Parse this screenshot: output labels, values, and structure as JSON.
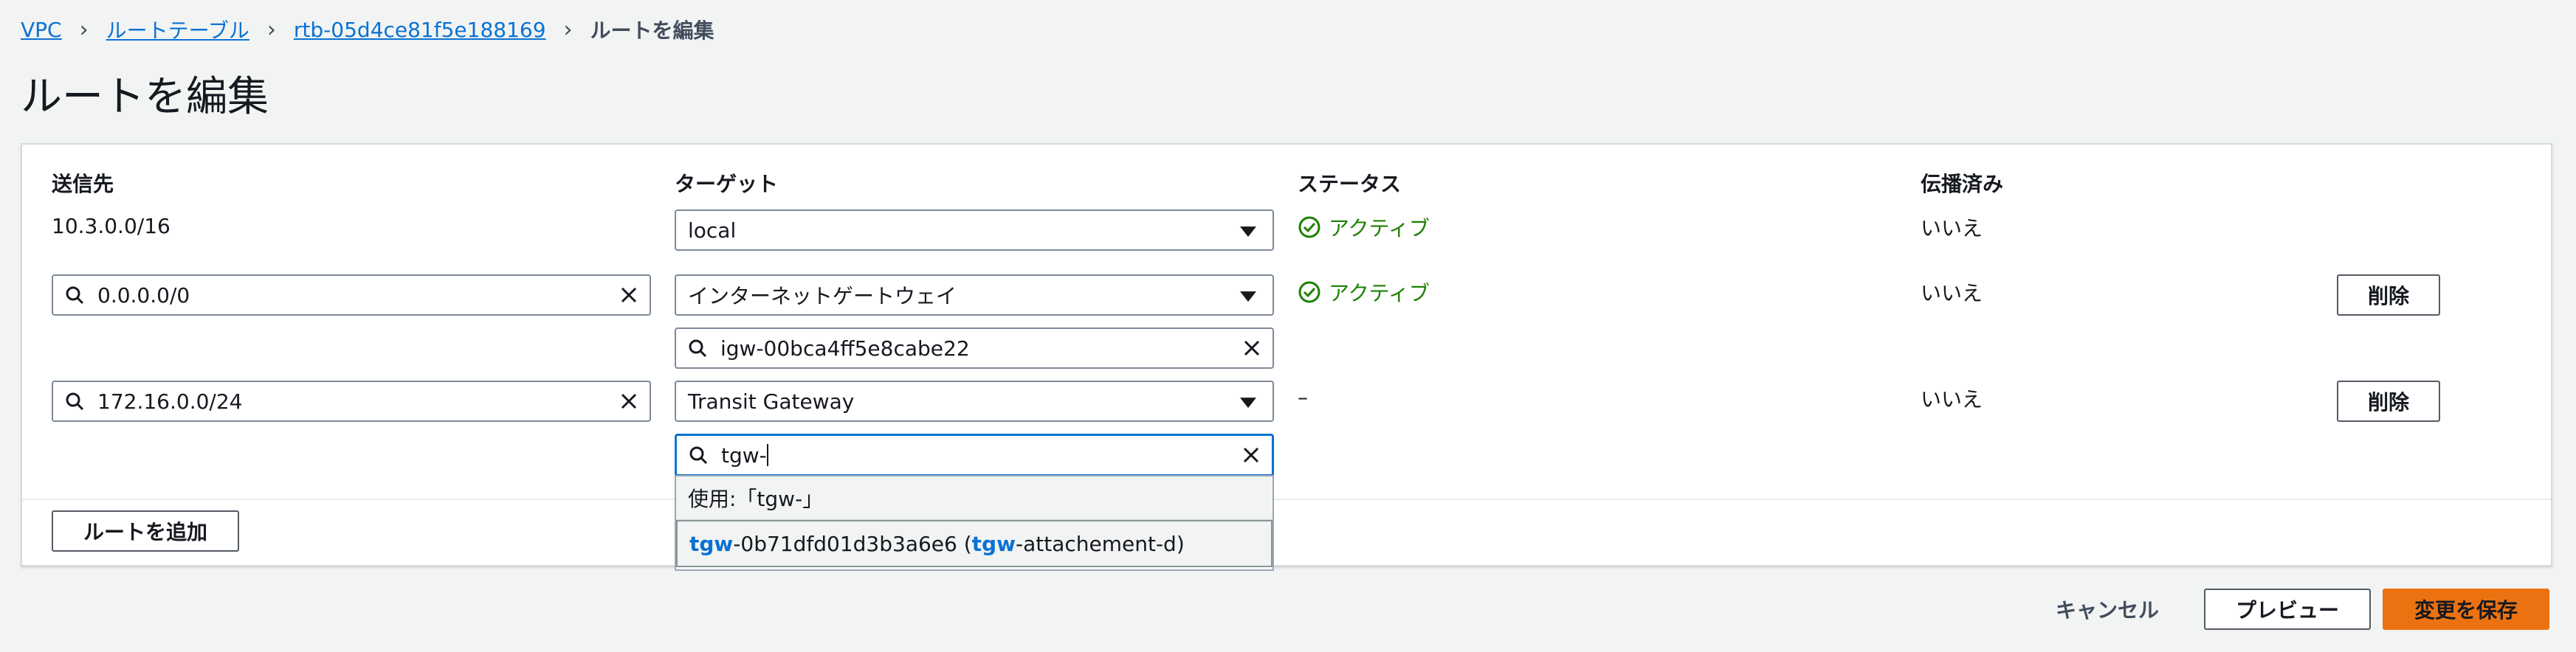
{
  "breadcrumb": {
    "items": [
      "VPC",
      "ルートテーブル",
      "rtb-05d4ce81f5e188169"
    ],
    "current": "ルートを編集"
  },
  "page_title": "ルートを編集",
  "columns": {
    "destination": "送信先",
    "target": "ターゲット",
    "status": "ステータス",
    "propagated": "伝播済み"
  },
  "rows": [
    {
      "destination": "10.3.0.0/16",
      "target": "local",
      "status": "アクティブ",
      "propagated": "いいえ"
    },
    {
      "destination": "0.0.0.0/0",
      "target": "インターネットゲートウェイ",
      "target_id": "igw-00bca4ff5e8cabe22",
      "status": "アクティブ",
      "propagated": "いいえ",
      "remove_label": "削除"
    },
    {
      "destination": "172.16.0.0/24",
      "target": "Transit Gateway",
      "target_search": "tgw-",
      "status": "–",
      "propagated": "いいえ",
      "remove_label": "削除"
    }
  ],
  "dropdown": {
    "use_text": "使用:「tgw-」",
    "option": {
      "hl1": "tgw",
      "rest1": "-0b71dfd01d3b3a6e6 (",
      "hl2": "tgw",
      "rest2": "-attachement-d)"
    }
  },
  "add_route_label": "ルートを追加",
  "footer": {
    "cancel": "キャンセル",
    "preview": "プレビュー",
    "save": "変更を保存"
  },
  "colors": {
    "accent": "#0972d3",
    "status_active": "#1d8102",
    "primary_button": "#ec7211"
  }
}
